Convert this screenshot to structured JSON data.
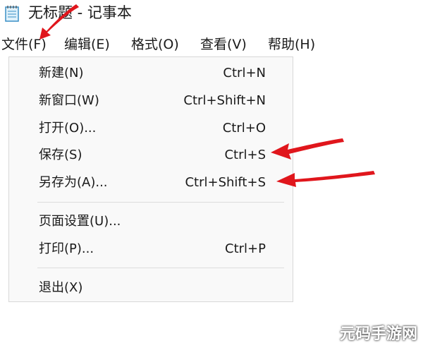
{
  "window": {
    "title": "无标题 - 记事本"
  },
  "menubar": {
    "file": "文件(F)",
    "edit": "编辑(E)",
    "format": "格式(O)",
    "view": "查看(V)",
    "help": "帮助(H)"
  },
  "file_menu": {
    "items": [
      {
        "label": "新建(N)",
        "shortcut": "Ctrl+N"
      },
      {
        "label": "新窗口(W)",
        "shortcut": "Ctrl+Shift+N"
      },
      {
        "label": "打开(O)...",
        "shortcut": "Ctrl+O"
      },
      {
        "label": "保存(S)",
        "shortcut": "Ctrl+S"
      },
      {
        "label": "另存为(A)...",
        "shortcut": "Ctrl+Shift+S"
      },
      {
        "label": "页面设置(U)...",
        "shortcut": ""
      },
      {
        "label": "打印(P)...",
        "shortcut": "Ctrl+P"
      },
      {
        "label": "退出(X)",
        "shortcut": ""
      }
    ]
  },
  "annotation_color": "#e0161c",
  "watermark": "元码手游网"
}
